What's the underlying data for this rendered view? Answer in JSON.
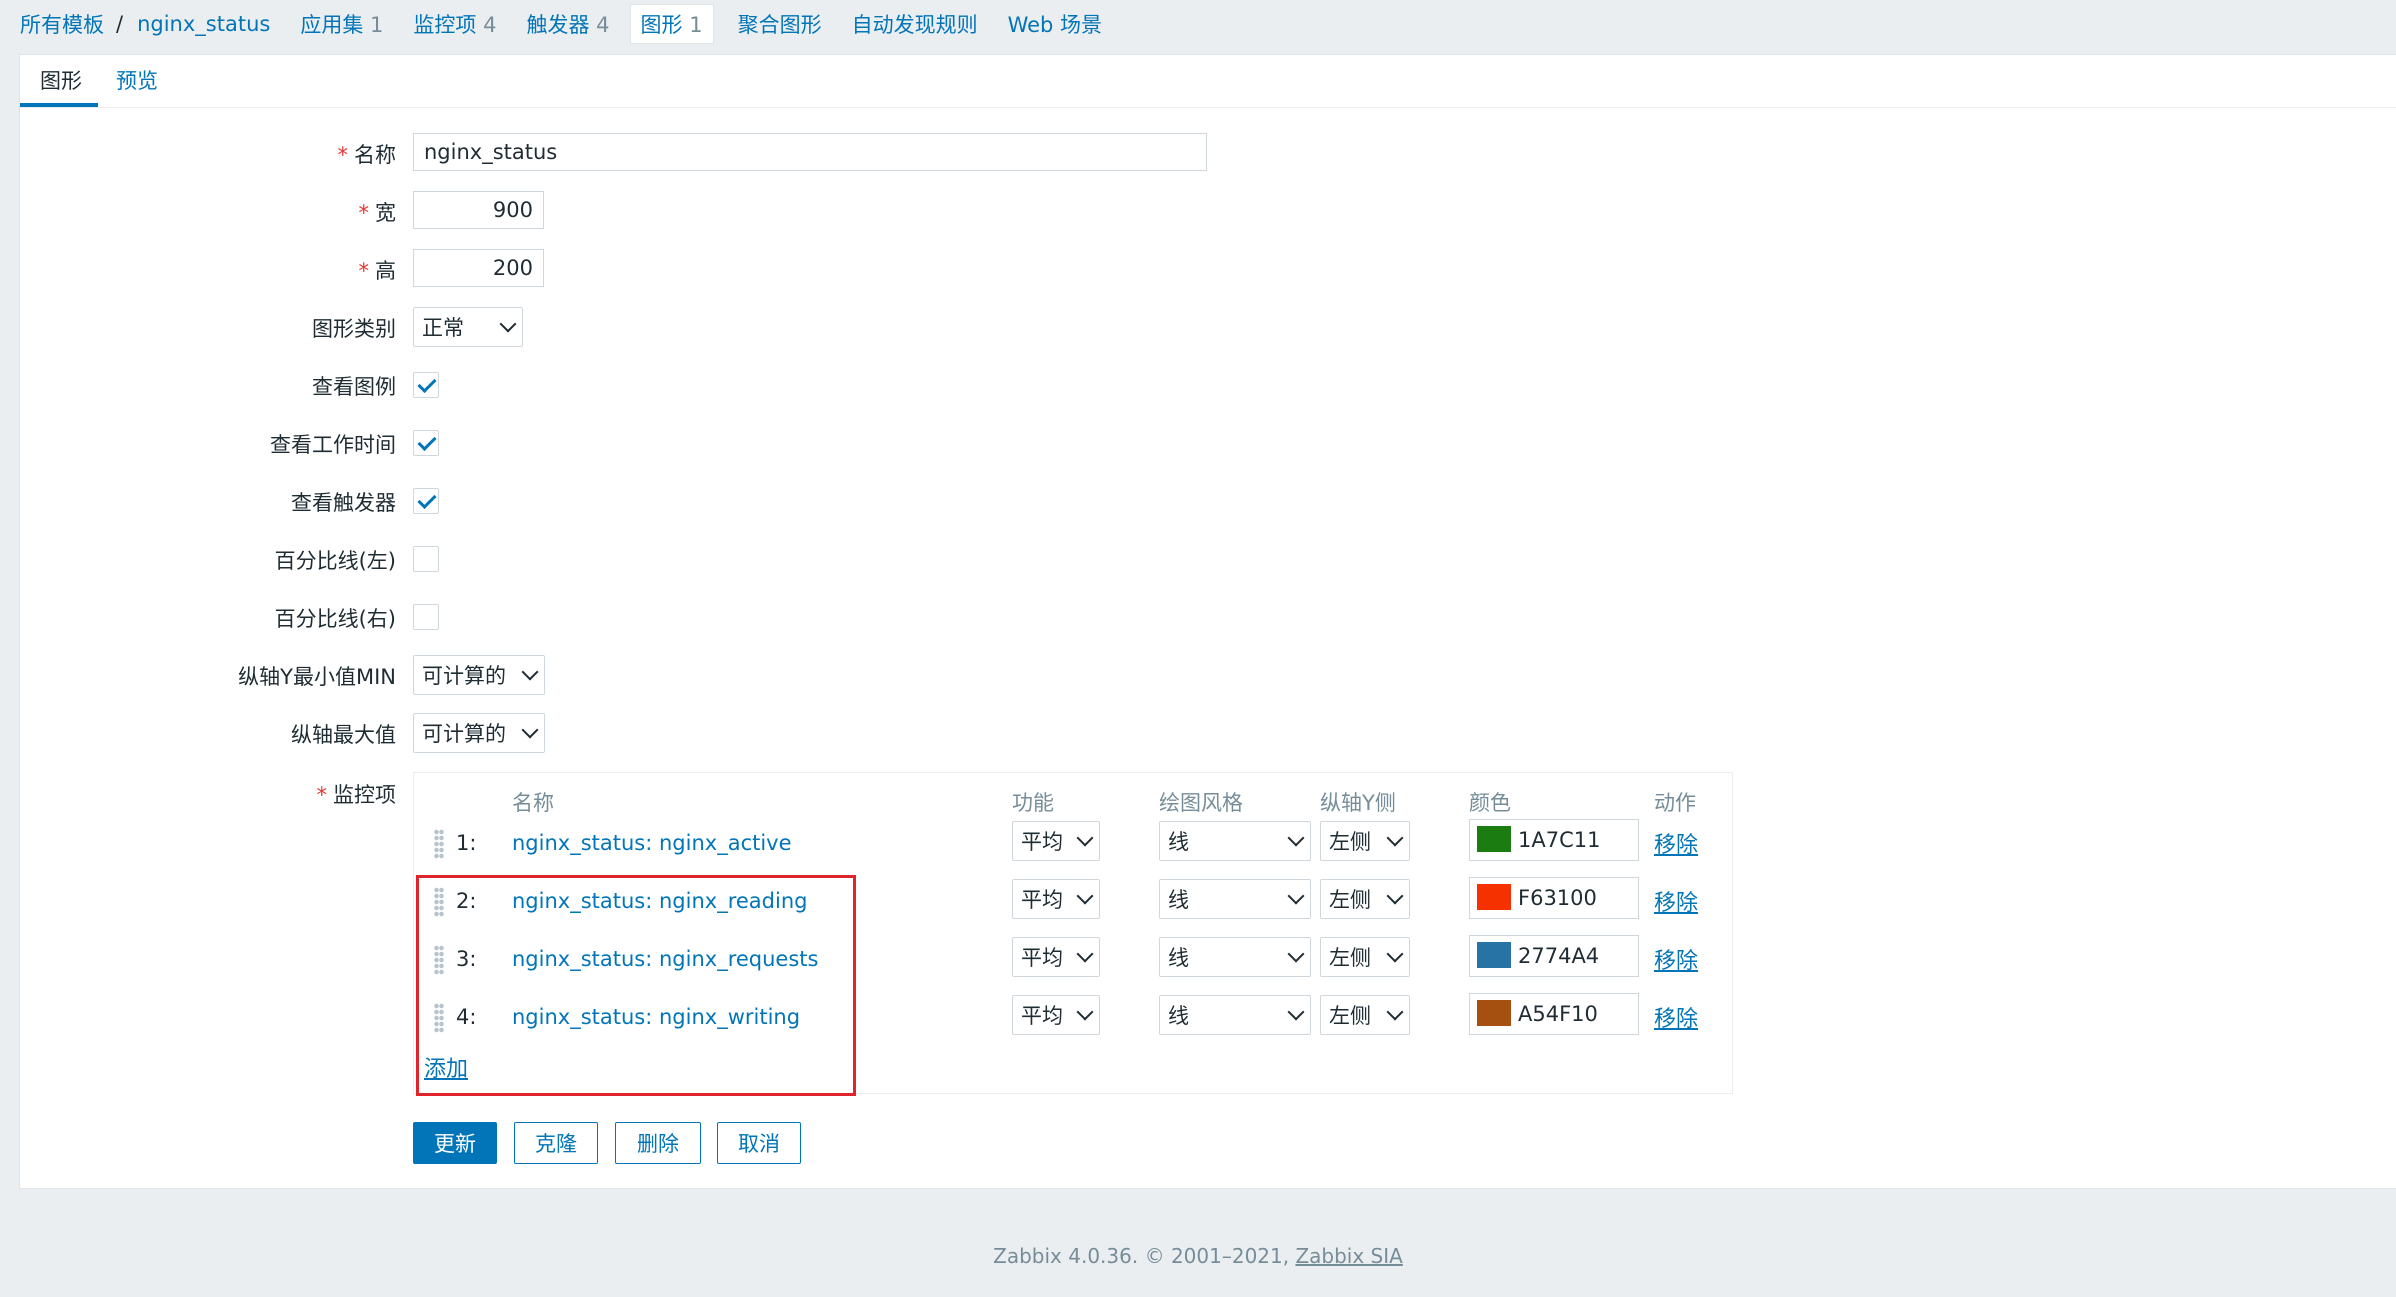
{
  "nav": {
    "all_templates": "所有模板",
    "separator": "/",
    "template_name": "nginx_status",
    "applications": "应用集",
    "applications_count": "1",
    "items": "监控项",
    "items_count": "4",
    "triggers": "触发器",
    "triggers_count": "4",
    "graphs": "图形",
    "graphs_count": "1",
    "screens": "聚合图形",
    "discovery": "自动发现规则",
    "web": "Web 场景"
  },
  "tabs": {
    "graph": "图形",
    "preview": "预览"
  },
  "form": {
    "name_label": "名称",
    "name_value": "nginx_status",
    "width_label": "宽",
    "width_value": "900",
    "height_label": "高",
    "height_value": "200",
    "type_label": "图形类别",
    "type_value": "正常",
    "show_legend_label": "查看图例",
    "show_legend": true,
    "show_worktime_label": "查看工作时间",
    "show_worktime": true,
    "show_triggers_label": "查看触发器",
    "show_triggers": true,
    "percentile_left_label": "百分比线(左)",
    "percentile_left": false,
    "percentile_right_label": "百分比线(右)",
    "percentile_right": false,
    "ymin_label": "纵轴Y最小值MIN",
    "ymin_value": "可计算的",
    "ymax_label": "纵轴最大值",
    "ymax_value": "可计算的",
    "items_label": "监控项",
    "required_mark": "*"
  },
  "items_table": {
    "headers": {
      "name": "名称",
      "function": "功能",
      "draw_style": "绘图风格",
      "y_axis": "纵轴Y侧",
      "color": "颜色",
      "action": "动作"
    },
    "rows": [
      {
        "index": "1:",
        "name": "nginx_status: nginx_active",
        "function": "平均",
        "draw_style": "线",
        "y_axis": "左侧",
        "color": "1A7C11",
        "action": "移除"
      },
      {
        "index": "2:",
        "name": "nginx_status: nginx_reading",
        "function": "平均",
        "draw_style": "线",
        "y_axis": "左侧",
        "color": "F63100",
        "action": "移除"
      },
      {
        "index": "3:",
        "name": "nginx_status: nginx_requests",
        "function": "平均",
        "draw_style": "线",
        "y_axis": "左侧",
        "color": "2774A4",
        "action": "移除"
      },
      {
        "index": "4:",
        "name": "nginx_status: nginx_writing",
        "function": "平均",
        "draw_style": "线",
        "y_axis": "左侧",
        "color": "A54F10",
        "action": "移除"
      }
    ],
    "add": "添加"
  },
  "buttons": {
    "update": "更新",
    "clone": "克隆",
    "delete": "删除",
    "cancel": "取消"
  },
  "footer": {
    "text": "Zabbix 4.0.36. © 2001–2021, ",
    "company": "Zabbix SIA"
  },
  "colors": {
    "accent": "#0275b8",
    "highlight": "#e0242c"
  }
}
